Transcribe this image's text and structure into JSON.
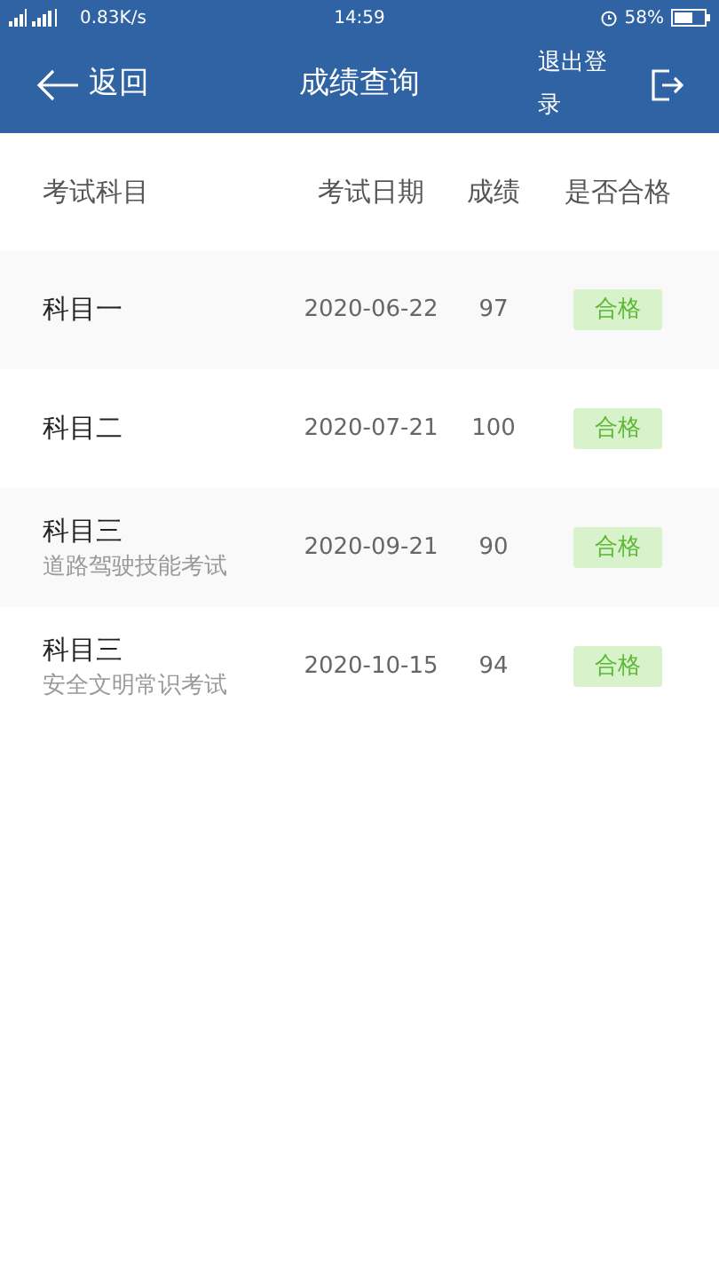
{
  "status_bar": {
    "network_speed": "0.83K/s",
    "time": "14:59",
    "battery": "58%"
  },
  "header": {
    "back": "返回",
    "title": "成绩查询",
    "logout": "退出登录"
  },
  "table": {
    "columns": [
      "考试科目",
      "考试日期",
      "成绩",
      "是否合格"
    ],
    "rows": [
      {
        "subject": "科目一",
        "date": "2020-06-22",
        "score": "97",
        "result": "合格"
      },
      {
        "subject": "科目二",
        "date": "2020-07-21",
        "score": "100",
        "result": "合格"
      },
      {
        "subject": "科目三",
        "subtitle": "道路驾驶技能考试",
        "date": "2020-09-21",
        "score": "90",
        "result": "合格"
      },
      {
        "subject": "科目三",
        "subtitle": "安全文明常识考试",
        "date": "2020-10-15",
        "score": "94",
        "result": "合格"
      }
    ]
  }
}
